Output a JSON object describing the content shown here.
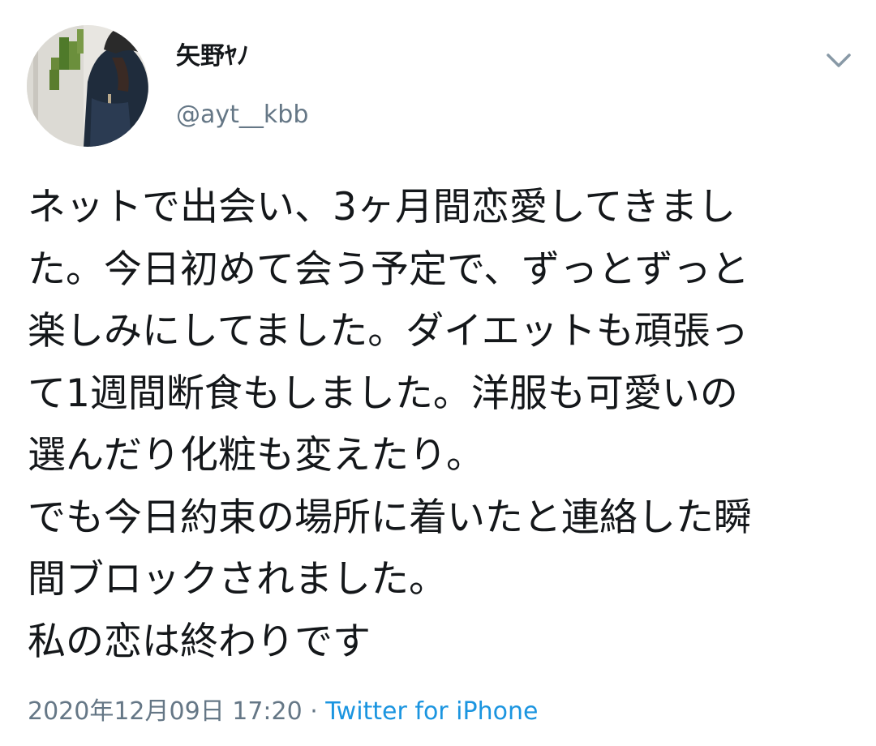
{
  "author": {
    "display_name": "矢野ﾔﾉ",
    "handle": "@ayt__kbb"
  },
  "tweet": {
    "lines": [
      "ネットで出会い、3ヶ月間恋愛してきまし",
      "た。今日初めて会う予定で、ずっとずっと",
      "楽しみにしてました。ダイエットも頑張っ",
      "て1週間断食もしました。洋服も可愛いの",
      "選んだり化粧も変えたり。",
      "でも今日約束の場所に着いたと連絡した瞬",
      "間ブロックされました。",
      "私の恋は終わりです"
    ]
  },
  "meta": {
    "timestamp": "2020年12月09日 17:20",
    "separator": " · ",
    "source": "Twitter for iPhone"
  },
  "icons": {
    "menu": "chevron-down-icon"
  },
  "colors": {
    "text": "#14171a",
    "secondary": "#657786",
    "link": "#1b95e0"
  }
}
